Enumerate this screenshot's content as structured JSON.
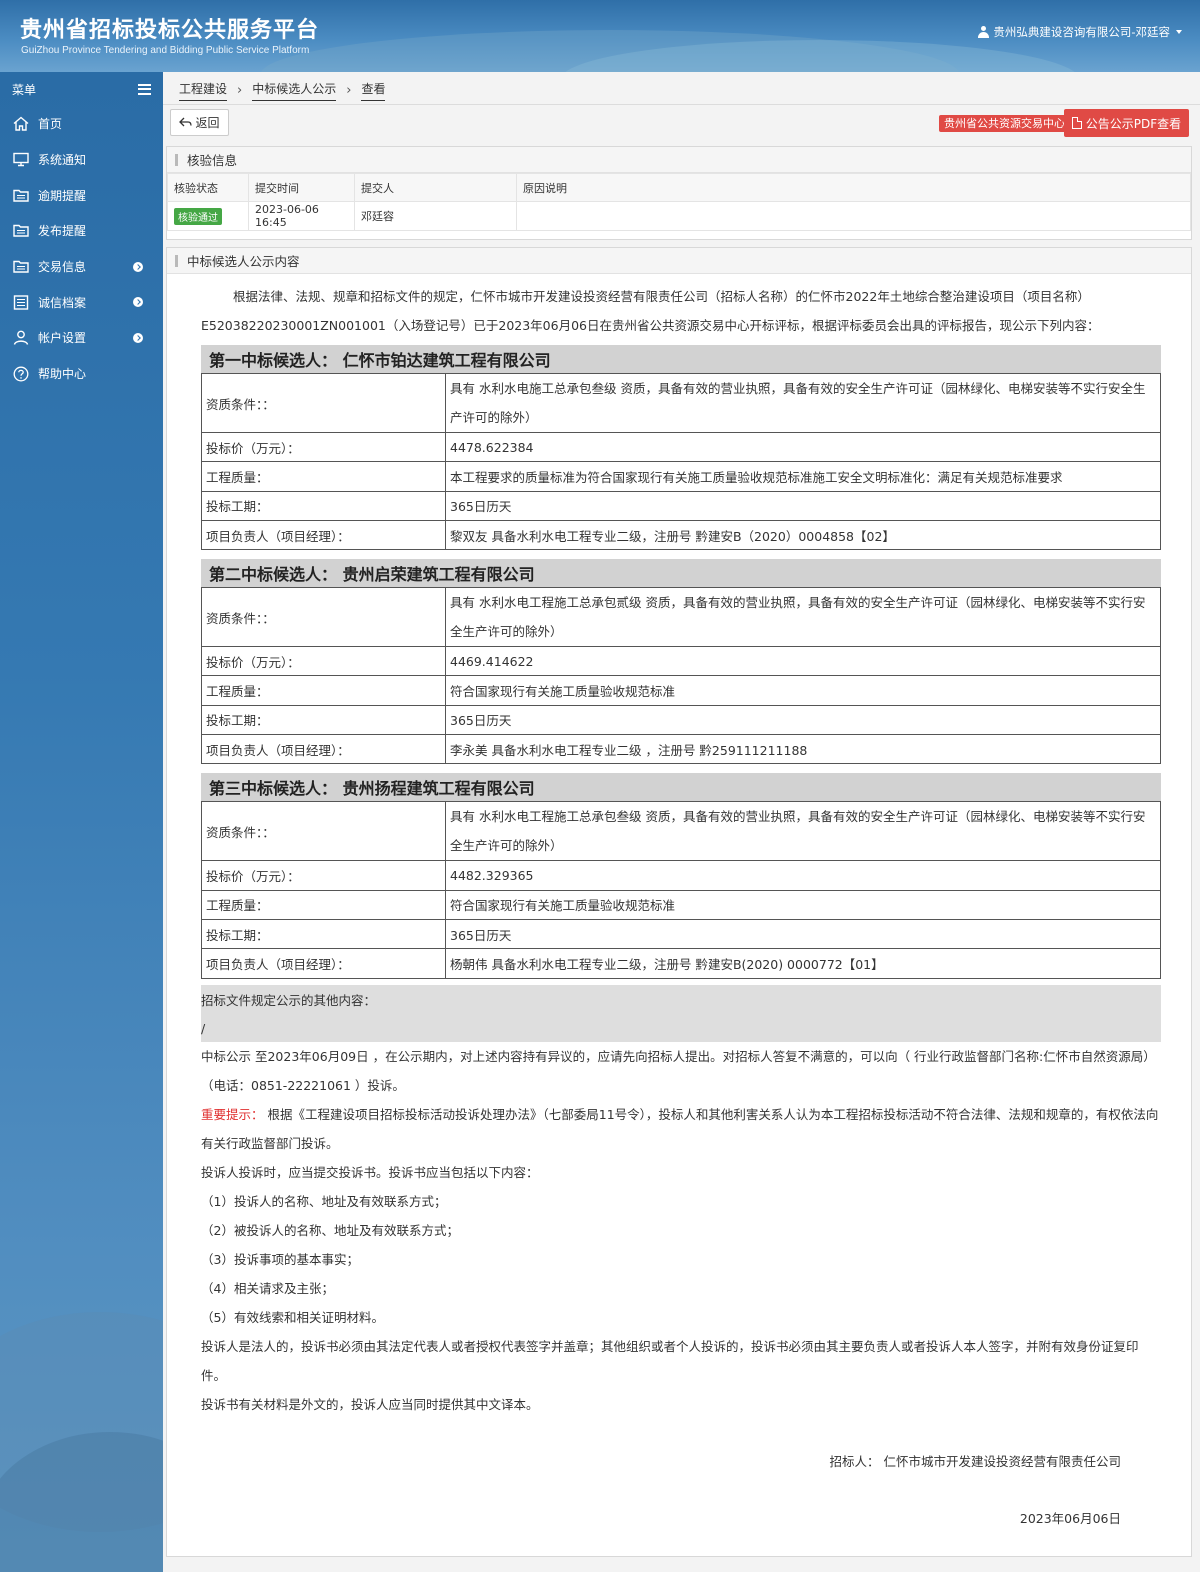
{
  "header": {
    "title": "贵州省招标投标公共服务平台",
    "subtitle": "GuiZhou Province Tendering and Bidding Public Service Platform",
    "user": "贵州弘典建设咨询有限公司-邓廷容"
  },
  "sidebar": {
    "menu_label": "菜单",
    "items": [
      {
        "label": "首页",
        "icon": "home-icon"
      },
      {
        "label": "系统通知",
        "icon": "monitor-icon"
      },
      {
        "label": "逾期提醒",
        "icon": "folder-icon"
      },
      {
        "label": "发布提醒",
        "icon": "folder-icon"
      },
      {
        "label": "交易信息",
        "icon": "folder-icon"
      },
      {
        "label": "诚信档案",
        "icon": "list-icon"
      },
      {
        "label": "帐户设置",
        "icon": "user-icon"
      },
      {
        "label": "帮助中心",
        "icon": "question-icon"
      }
    ]
  },
  "breadcrumb": [
    "工程建设",
    "中标候选人公示",
    "查看"
  ],
  "toolbar": {
    "back": "返回",
    "center_tag": "贵州省公共资源交易中心",
    "pdf": "公告公示PDF查看"
  },
  "verify": {
    "title": "核验信息",
    "headers": [
      "核验状态",
      "提交时间",
      "提交人",
      "原因说明"
    ],
    "row": {
      "status": "核验通过",
      "time": "2023-06-06 16:45",
      "submitter": "邓廷容",
      "reason": ""
    }
  },
  "notice": {
    "title": "中标候选人公示内容",
    "intro1": "根据法律、法规、规章和招标文件的规定，仁怀市城市开发建设投资经营有限责任公司（招标人名称）的仁怀市2022年土地综合整治建设项目（项目名称）",
    "intro2": "E52038220230001ZN001001（入场登记号）已于2023年06月06日在贵州省公共资源交易中心开标评标，根据评标委员会出具的评标报告，现公示下列内容：",
    "labels": {
      "qual": "资质条件：：",
      "price": "投标价（万元）：",
      "quality": "工程质量：",
      "period": "投标工期：",
      "manager": "项目负责人（项目经理）："
    },
    "candidates": [
      {
        "heading": "第一中标候选人： 仁怀市铂达建筑工程有限公司",
        "qual": "具有 水利水电施工总承包叁级 资质，具备有效的营业执照，具备有效的安全生产许可证（园林绿化、电梯安装等不实行安全生产许可的除外）",
        "price": "4478.622384",
        "quality": "本工程要求的质量标准为符合国家现行有关施工质量验收规范标准施工安全文明标准化：满足有关规范标准要求",
        "period": "365日历天",
        "manager": "黎双友 具备水利水电工程专业二级，注册号 黔建安B（2020）0004858【02】"
      },
      {
        "heading": "第二中标候选人： 贵州启荣建筑工程有限公司",
        "qual": "具有 水利水电工程施工总承包贰级 资质，具备有效的营业执照，具备有效的安全生产许可证（园林绿化、电梯安装等不实行安全生产许可的除外）",
        "price": "4469.414622",
        "quality": "符合国家现行有关施工质量验收规范标准",
        "period": "365日历天",
        "manager": "李永美 具备水利水电工程专业二级 ，注册号 黔259111211188"
      },
      {
        "heading": "第三中标候选人： 贵州扬程建筑工程有限公司",
        "qual": "具有 水利水电工程施工总承包叁级 资质，具备有效的营业执照，具备有效的安全生产许可证（园林绿化、电梯安装等不实行安全生产许可的除外）",
        "price": "4482.329365",
        "quality": "符合国家现行有关施工质量验收规范标准",
        "period": "365日历天",
        "manager": "杨朝伟 具备水利水电工程专业二级，注册号 黔建安B(2020) 0000772【01】"
      }
    ],
    "other_label": "招标文件规定公示的其他内容：",
    "other_value": "/",
    "period_text": "中标公示 至2023年06月09日 ，在公示期内，对上述内容持有异议的，应请先向招标人提出。对招标人答复不满意的，可以向（ 行业行政监督部门名称:仁怀市自然资源局）（电话：0851-22221061 ）投诉。",
    "important_label": "重要提示：",
    "important_text": " 根据《工程建设项目招标投标活动投诉处理办法》（七部委局11号令），投标人和其他利害关系人认为本工程招标投标活动不符合法律、法规和规章的，有权依法向有关行政监督部门投诉。",
    "complaint_intro": "投诉人投诉时，应当提交投诉书。投诉书应当包括以下内容：",
    "complaint_items": [
      "（1）投诉人的名称、地址及有效联系方式；",
      "（2）被投诉人的名称、地址及有效联系方式；",
      "（3）投诉事项的基本事实；",
      "（4）相关请求及主张；",
      "（5）有效线索和相关证明材料。"
    ],
    "legal_person": "投诉人是法人的，投诉书必须由其法定代表人或者授权代表签字并盖章；其他组织或者个人投诉的，投诉书必须由其主要负责人或者投诉人本人签字，并附有效身份证复印件。",
    "foreign": "投诉书有关材料是外文的，投诉人应当同时提供其中文译本。",
    "signer": "招标人： 仁怀市城市开发建设投资经营有限责任公司",
    "date": "2023年06月06日"
  }
}
